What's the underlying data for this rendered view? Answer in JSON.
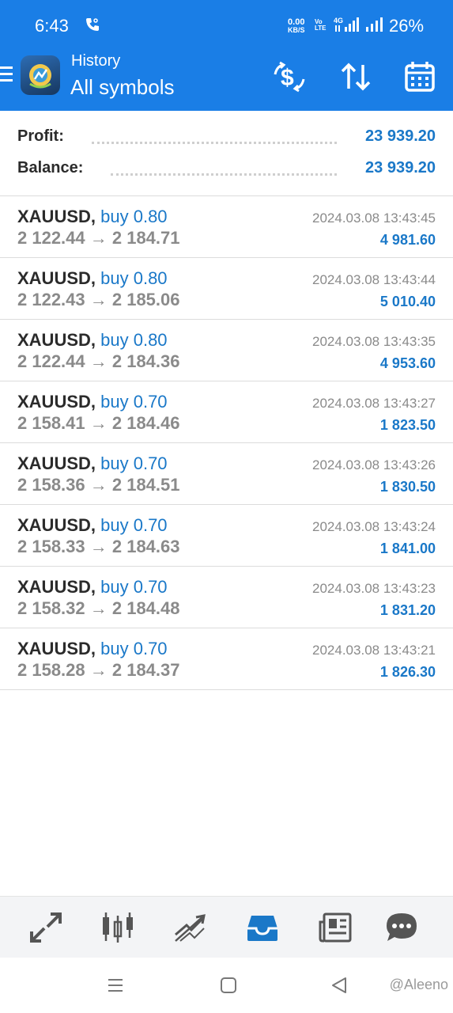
{
  "status_bar": {
    "time": "6:43",
    "net_speed_value": "0.00",
    "net_speed_unit": "KB/S",
    "volte": "Vo LTE",
    "network": "4G",
    "battery": "26%"
  },
  "app_bar": {
    "title": "History",
    "subtitle": "All symbols"
  },
  "summary": {
    "profit_label": "Profit:",
    "profit_value": "23 939.20",
    "balance_label": "Balance:",
    "balance_value": "23 939.20"
  },
  "trades": [
    {
      "symbol": "XAUUSD,",
      "side": "buy 0.80",
      "prices": "2 122.44 → 2 184.71",
      "time": "2024.03.08 13:43:45",
      "profit": "4 981.60"
    },
    {
      "symbol": "XAUUSD,",
      "side": "buy 0.80",
      "prices": "2 122.43 → 2 185.06",
      "time": "2024.03.08 13:43:44",
      "profit": "5 010.40"
    },
    {
      "symbol": "XAUUSD,",
      "side": "buy 0.80",
      "prices": "2 122.44 → 2 184.36",
      "time": "2024.03.08 13:43:35",
      "profit": "4 953.60"
    },
    {
      "symbol": "XAUUSD,",
      "side": "buy 0.70",
      "prices": "2 158.41 → 2 184.46",
      "time": "2024.03.08 13:43:27",
      "profit": "1 823.50"
    },
    {
      "symbol": "XAUUSD,",
      "side": "buy 0.70",
      "prices": "2 158.36 → 2 184.51",
      "time": "2024.03.08 13:43:26",
      "profit": "1 830.50"
    },
    {
      "symbol": "XAUUSD,",
      "side": "buy 0.70",
      "prices": "2 158.33 → 2 184.63",
      "time": "2024.03.08 13:43:24",
      "profit": "1 841.00"
    },
    {
      "symbol": "XAUUSD,",
      "side": "buy 0.70",
      "prices": "2 158.32 → 2 184.48",
      "time": "2024.03.08 13:43:23",
      "profit": "1 831.20"
    },
    {
      "symbol": "XAUUSD,",
      "side": "buy 0.70",
      "prices": "2 158.28 → 2 184.37",
      "time": "2024.03.08 13:43:21",
      "profit": "1 826.30"
    }
  ],
  "bottom_nav": {
    "active": "history",
    "items": [
      "quotes-icon",
      "chart-icon",
      "trade-icon",
      "history-icon",
      "news-icon",
      "chat-icon"
    ]
  },
  "watermark": "@Aleeno",
  "colors": {
    "accent": "#1a7ee6",
    "link_blue": "#1a78c8",
    "text_dark": "#2b2b2b",
    "text_gray": "#8a8a8a"
  }
}
